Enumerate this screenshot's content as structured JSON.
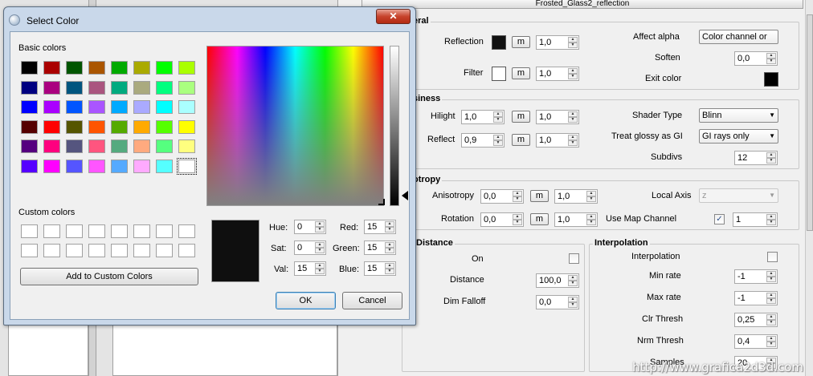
{
  "background_window": {
    "material_tab_title": "Frosted_Glass2_reflection",
    "general": {
      "title": "eral",
      "reflection_label": "Reflection",
      "reflection_color": "#111111",
      "reflection_map": "m",
      "reflection_value": "1,0",
      "filter_label": "Filter",
      "filter_color": "#ffffff",
      "filter_map": "m",
      "filter_value": "1,0",
      "affect_alpha_label": "Affect alpha",
      "affect_alpha_value": "Color channel or",
      "soften_label": "Soften",
      "soften_value": "0,0",
      "exit_color_label": "Exit color",
      "exit_color": "#000000"
    },
    "glossiness": {
      "title": "siness",
      "hilight_label": "Hilight",
      "hilight_value": "1,0",
      "hilight_map": "m",
      "hilight_mult": "1,0",
      "reflect_label": "Reflect",
      "reflect_value": "0,9",
      "reflect_map": "m",
      "reflect_mult": "1,0",
      "shader_type_label": "Shader Type",
      "shader_type_value": "Blinn",
      "treat_glossy_label": "Treat glossy as GI",
      "treat_glossy_value": "GI rays only",
      "subdivs_label": "Subdivs",
      "subdivs_value": "12"
    },
    "anisotropy": {
      "title": "otropy",
      "anisotropy_label": "Anisotropy",
      "anisotropy_value": "0,0",
      "anisotropy_map": "m",
      "anisotropy_mult": "1,0",
      "rotation_label": "Rotation",
      "rotation_value": "0,0",
      "rotation_map": "m",
      "rotation_mult": "1,0",
      "local_axis_label": "Local Axis",
      "local_axis_value": "z",
      "use_map_channel_label": "Use Map Channel",
      "use_map_channel_checked": "✓",
      "use_map_channel_value": "1"
    },
    "distance": {
      "title": "Distance",
      "on_label": "On",
      "distance_label": "Distance",
      "distance_value": "100,0",
      "dim_falloff_label": "Dim Falloff",
      "dim_falloff_value": "0,0"
    },
    "interpolation": {
      "title": "Interpolation",
      "interpolation_label": "Interpolation",
      "min_rate_label": "Min rate",
      "min_rate_value": "-1",
      "max_rate_label": "Max rate",
      "max_rate_value": "-1",
      "clr_thresh_label": "Clr Thresh",
      "clr_thresh_value": "0,25",
      "nrm_thresh_label": "Nrm Thresh",
      "nrm_thresh_value": "0,4",
      "samples_label": "Samples",
      "samples_value": "20"
    }
  },
  "dialog": {
    "title": "Select Color",
    "close_label": "✕",
    "basic_colors_label": "Basic colors",
    "basic_colors": [
      [
        "#000000",
        "#aa0000",
        "#005500",
        "#aa5500",
        "#00aa00",
        "#aaaa00",
        "#00ff00",
        "#aaff00"
      ],
      [
        "#000080",
        "#aa007f",
        "#00557f",
        "#aa557f",
        "#00aa7f",
        "#aaaa7f",
        "#00ff7f",
        "#aaff7f"
      ],
      [
        "#0000ff",
        "#aa00ff",
        "#0055ff",
        "#aa55ff",
        "#00aaff",
        "#aaaaff",
        "#00ffff",
        "#aaffff"
      ],
      [
        "#550000",
        "#ff0000",
        "#555500",
        "#ff5500",
        "#55aa00",
        "#ffaa00",
        "#55ff00",
        "#ffff00"
      ],
      [
        "#55007f",
        "#ff007f",
        "#55557f",
        "#ff557f",
        "#55aa7f",
        "#ffaa7f",
        "#55ff7f",
        "#ffff7f"
      ],
      [
        "#5500ff",
        "#ff00ff",
        "#5555ff",
        "#ff55ff",
        "#55aaff",
        "#ffaaff",
        "#55ffff",
        "#ffffff"
      ]
    ],
    "custom_colors_label": "Custom colors",
    "add_custom_label": "Add to Custom Colors",
    "hue_label": "Hue:",
    "hue_value": "0",
    "sat_label": "Sat:",
    "sat_value": "0",
    "val_label": "Val:",
    "val_value": "15",
    "red_label": "Red:",
    "red_value": "15",
    "green_label": "Green:",
    "green_value": "15",
    "blue_label": "Blue:",
    "blue_value": "15",
    "current_color": "#0f0f0f",
    "ok_label": "OK",
    "cancel_label": "Cancel"
  },
  "watermark": "http://www.grafica2d3d.com"
}
